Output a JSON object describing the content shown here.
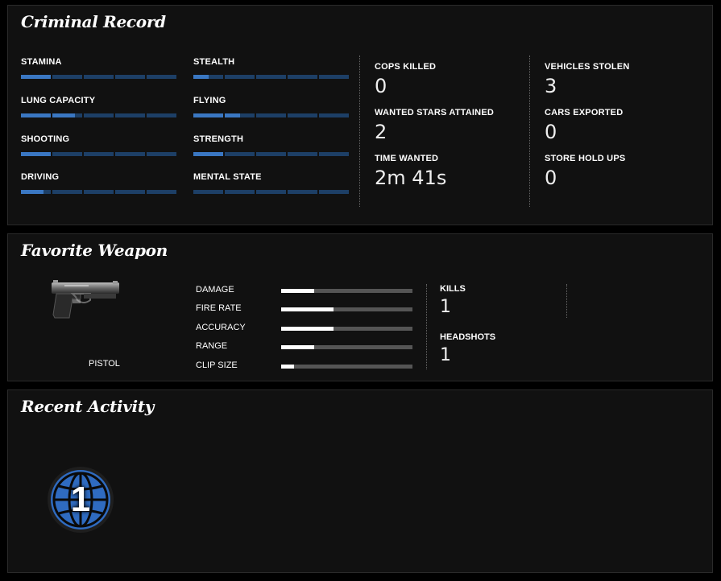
{
  "criminal_record": {
    "title": "Criminal Record",
    "skills": [
      {
        "label": "STAMINA",
        "level": 0.2
      },
      {
        "label": "STEALTH",
        "level": 0.1
      },
      {
        "label": "LUNG CAPACITY",
        "level": 0.35
      },
      {
        "label": "FLYING",
        "level": 0.3
      },
      {
        "label": "SHOOTING",
        "level": 0.2
      },
      {
        "label": "STRENGTH",
        "level": 0.2
      },
      {
        "label": "DRIVING",
        "level": 0.15
      },
      {
        "label": "MENTAL STATE",
        "level": 0.0
      }
    ],
    "stats": [
      {
        "label": "COPS KILLED",
        "value": "0"
      },
      {
        "label": "WANTED STARS ATTAINED",
        "value": "2"
      },
      {
        "label": "TIME WANTED",
        "value": "2m 41s"
      },
      {
        "label": "VEHICLES STOLEN",
        "value": "3"
      },
      {
        "label": "CARS EXPORTED",
        "value": "0"
      },
      {
        "label": "STORE HOLD UPS",
        "value": "0"
      }
    ]
  },
  "favorite_weapon": {
    "title": "Favorite Weapon",
    "weapon_name": "PISTOL",
    "weapon_icon": "pistol-icon",
    "stats": [
      {
        "label": "DAMAGE",
        "level": 0.25
      },
      {
        "label": "FIRE RATE",
        "level": 0.4
      },
      {
        "label": "ACCURACY",
        "level": 0.4
      },
      {
        "label": "RANGE",
        "level": 0.25
      },
      {
        "label": "CLIP SIZE",
        "level": 0.1
      }
    ],
    "kills_label": "KILLS",
    "kills_value": "1",
    "headshots_label": "HEADSHOTS",
    "headshots_value": "1"
  },
  "recent_activity": {
    "title": "Recent Activity",
    "badge_icon": "globe-icon",
    "badge_number": "1",
    "colors": {
      "badge_blue": "#2f6bc0"
    }
  },
  "colors": {
    "bar_empty": "#1d3f66",
    "bar_fill": "#3a77c2",
    "weapon_bar_bg": "#555555",
    "weapon_bar_fill": "#ffffff"
  }
}
